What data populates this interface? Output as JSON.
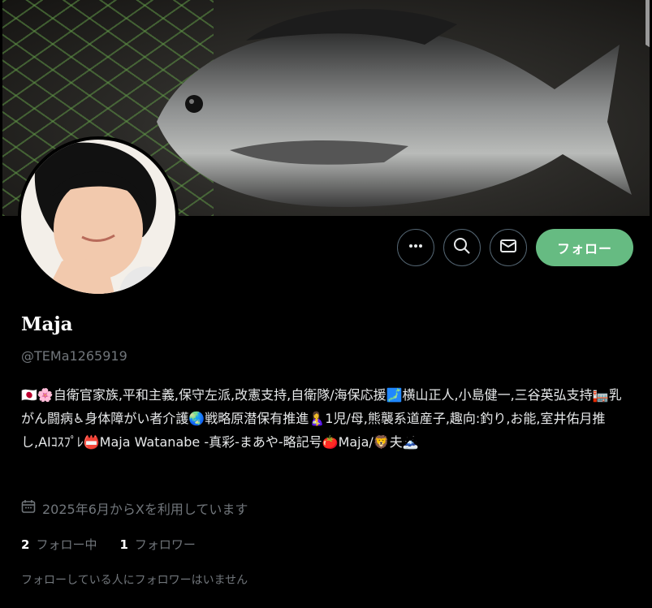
{
  "profile": {
    "name": "Maja",
    "handle": "@TEMa1265919",
    "bio": "🇯🇵🌸自衛官家族,平和主義,保守左派,改憲支持,自衛隊/海保応援🗾横山正人,小島健一,三谷英弘支持🏣乳がん闘病♿身体障がい者介護🌏戦略原潜保有推進🤱1児/母,熊襲系道産子,趣向:釣り,お能,室井佑月推し,AIｺｽﾌﾟﾚ📛Maja Watanabe -真彩-まあや-略記号🍅Maja/🦁夫🗻",
    "joined": "2025年6月からXを利用しています",
    "following_count": "2",
    "following_label": "フォロー中",
    "followers_count": "1",
    "followers_label": "フォロワー",
    "no_mutuals": "フォローしている人にフォロワーはいません"
  },
  "actions": {
    "more_icon": "more-icon",
    "search_icon": "search-icon",
    "message_icon": "mail-icon",
    "follow_label": "フォロー",
    "follow_color": "#66bb82"
  }
}
